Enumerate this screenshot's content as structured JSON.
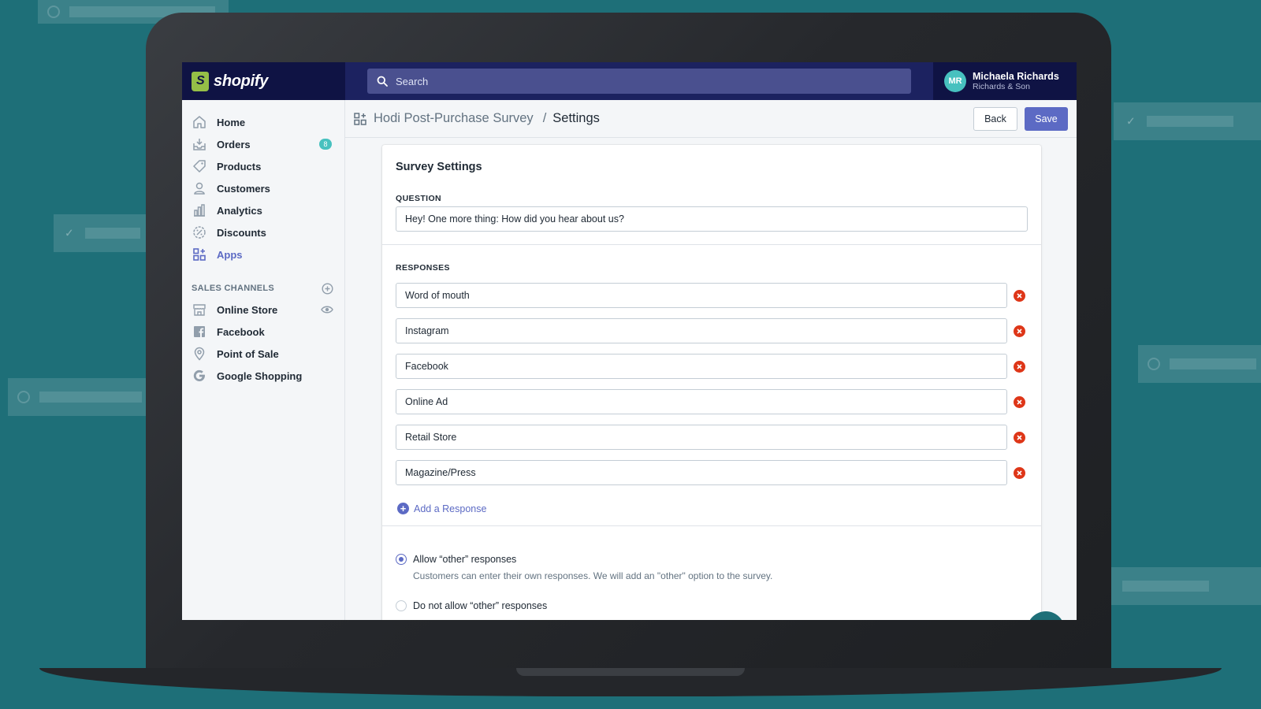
{
  "brand": {
    "logo_text": "shopify"
  },
  "topbar": {
    "search_placeholder": "Search"
  },
  "user": {
    "initials": "MR",
    "name": "Michaela Richards",
    "store": "Richards & Son"
  },
  "sidebar": {
    "items": [
      {
        "label": "Home",
        "icon": "home-icon"
      },
      {
        "label": "Orders",
        "icon": "orders-icon",
        "badge": "8"
      },
      {
        "label": "Products",
        "icon": "tag-icon"
      },
      {
        "label": "Customers",
        "icon": "person-icon"
      },
      {
        "label": "Analytics",
        "icon": "chart-icon"
      },
      {
        "label": "Discounts",
        "icon": "discount-icon"
      },
      {
        "label": "Apps",
        "icon": "apps-icon",
        "active": true
      }
    ],
    "channels_heading": "SALES CHANNELS",
    "channels": [
      {
        "label": "Online Store",
        "icon": "store-icon"
      },
      {
        "label": "Facebook",
        "icon": "facebook-icon"
      },
      {
        "label": "Point of Sale",
        "icon": "location-icon"
      },
      {
        "label": "Google Shopping",
        "icon": "google-icon"
      }
    ]
  },
  "header": {
    "app_name": "Hodi Post-Purchase Survey",
    "separator": "/",
    "page_title": "Settings",
    "back_label": "Back",
    "save_label": "Save"
  },
  "survey": {
    "title": "Survey Settings",
    "question_label": "QUESTION",
    "question_value": "Hey! One more thing: How did you hear about us?",
    "responses_label": "RESPONSES",
    "responses": [
      "Word of mouth",
      "Instagram",
      "Facebook",
      "Online Ad",
      "Retail Store",
      "Magazine/Press"
    ],
    "add_response_label": "Add a Response",
    "options": [
      {
        "label": "Allow “other” responses",
        "help": "Customers can enter their own responses. We will add an \"other\" option to the survey.",
        "selected": true
      },
      {
        "label": "Do not allow “other” responses",
        "help": "",
        "selected": false
      }
    ]
  },
  "colors": {
    "background": "#1e6f78",
    "topbar": "#1c2260",
    "accent": "#5c6ac4",
    "badge": "#47c1bf",
    "danger": "#de3618"
  }
}
